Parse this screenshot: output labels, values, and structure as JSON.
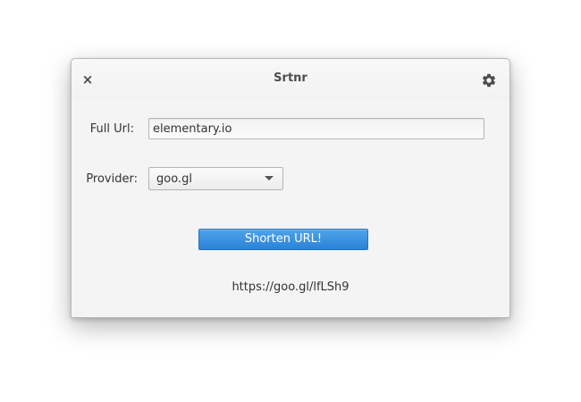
{
  "window": {
    "title": "Srtnr"
  },
  "headerbar": {
    "close_glyph": "×",
    "close_icon": "close-icon",
    "settings_icon": "gear-icon"
  },
  "form": {
    "url_label": "Full Url:",
    "url_value": "elementary.io",
    "provider_label": "Provider:",
    "provider_value": "goo.gl",
    "shorten_label": "Shorten URL!"
  },
  "result": {
    "short_url": "https://goo.gl/lfLSh9"
  },
  "colors": {
    "accent": "#3689e6",
    "window_bg": "#f4f4f4",
    "text": "#333333"
  }
}
